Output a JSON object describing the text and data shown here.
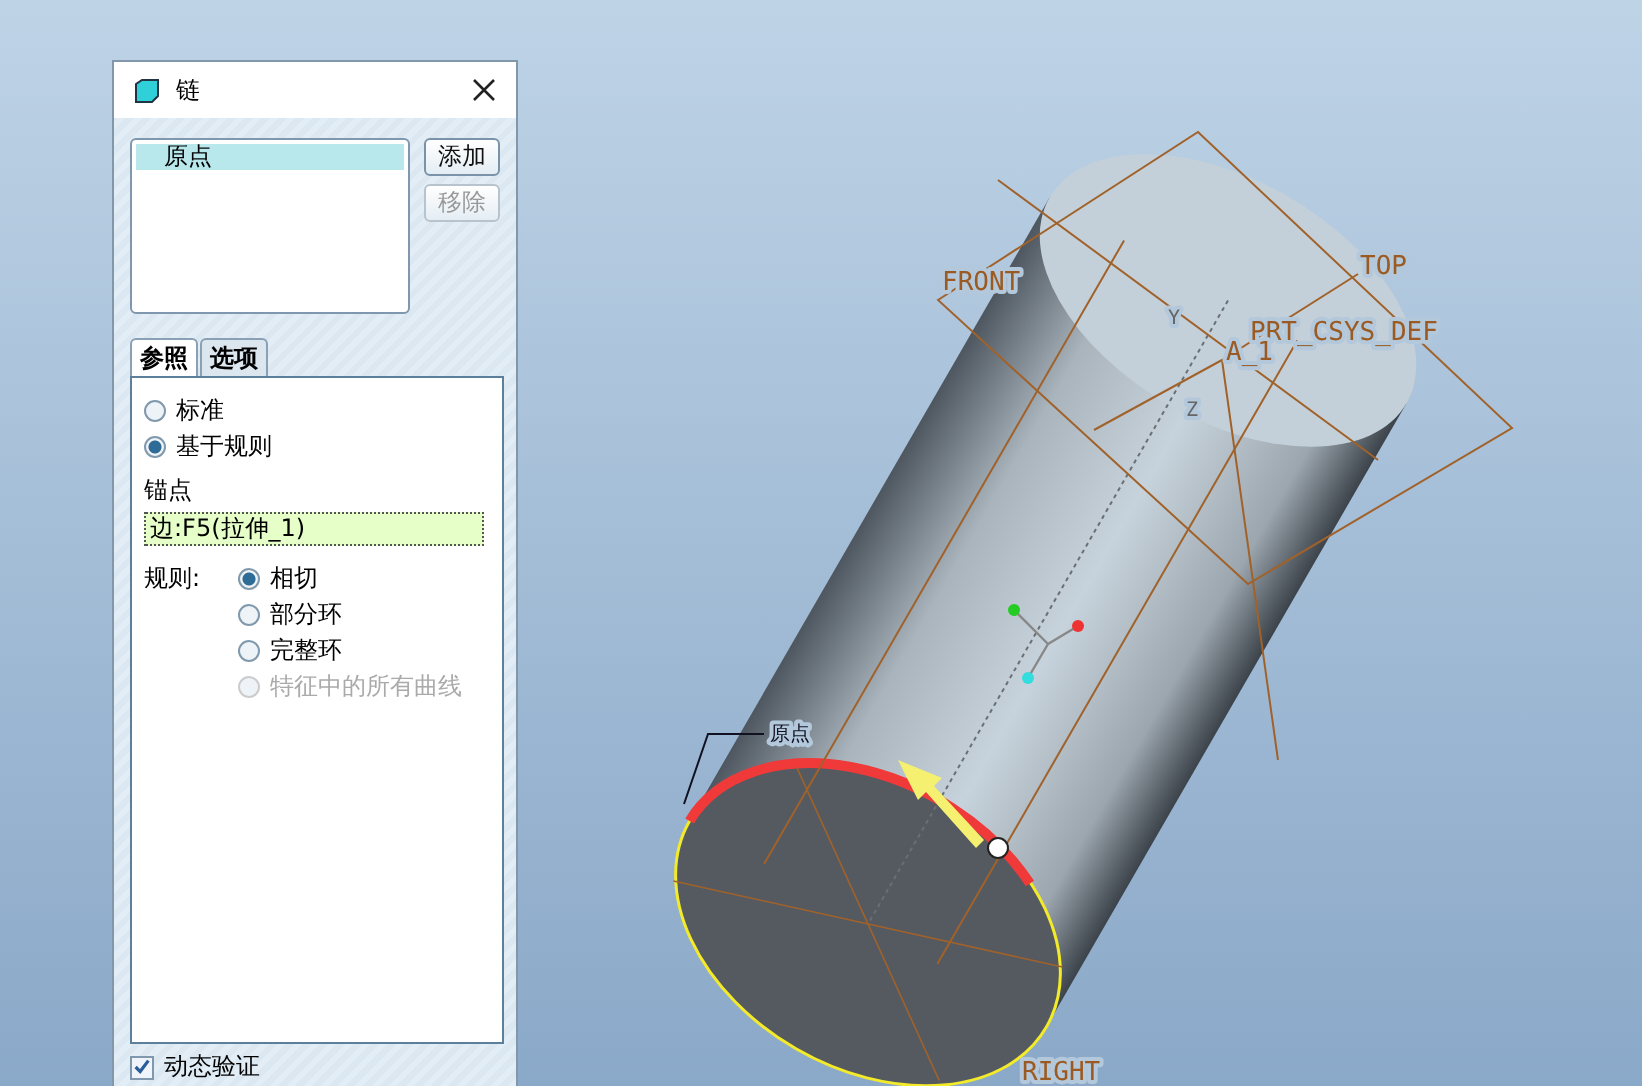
{
  "dialog": {
    "title": "链",
    "list": [
      {
        "label": "原点",
        "selected": true
      }
    ],
    "buttons": [
      {
        "label": "添加",
        "disabled": false
      },
      {
        "label": "移除",
        "disabled": true
      }
    ],
    "tabs": [
      {
        "label": "参照",
        "selected": true
      },
      {
        "label": "选项",
        "selected": false
      }
    ],
    "mode_options": [
      {
        "label": "标准",
        "selected": false
      },
      {
        "label": "基于规则",
        "selected": true
      }
    ],
    "anchor": {
      "label": "锚点",
      "value": "边:F5(拉伸_1)"
    },
    "rule": {
      "label": "规则:",
      "options": [
        {
          "label": "相切",
          "selected": true,
          "disabled": false
        },
        {
          "label": "部分环",
          "selected": false,
          "disabled": false
        },
        {
          "label": "完整环",
          "selected": false,
          "disabled": false
        },
        {
          "label": "特征中的所有曲线",
          "selected": false,
          "disabled": true
        }
      ]
    },
    "dynamic_check": {
      "label": "动态验证",
      "checked": true
    }
  },
  "viewport": {
    "labels": [
      {
        "kind": "datum",
        "text": "FRONT"
      },
      {
        "kind": "datum",
        "text": "TOP"
      },
      {
        "kind": "datum",
        "text": "PRT_CSYS_DEF"
      },
      {
        "kind": "datum",
        "text": "A_1"
      },
      {
        "kind": "axis",
        "text": "Y"
      },
      {
        "kind": "axis",
        "text": "Z"
      },
      {
        "kind": "note",
        "text": "原点"
      },
      {
        "kind": "datum",
        "text": "RIGHT"
      }
    ]
  }
}
